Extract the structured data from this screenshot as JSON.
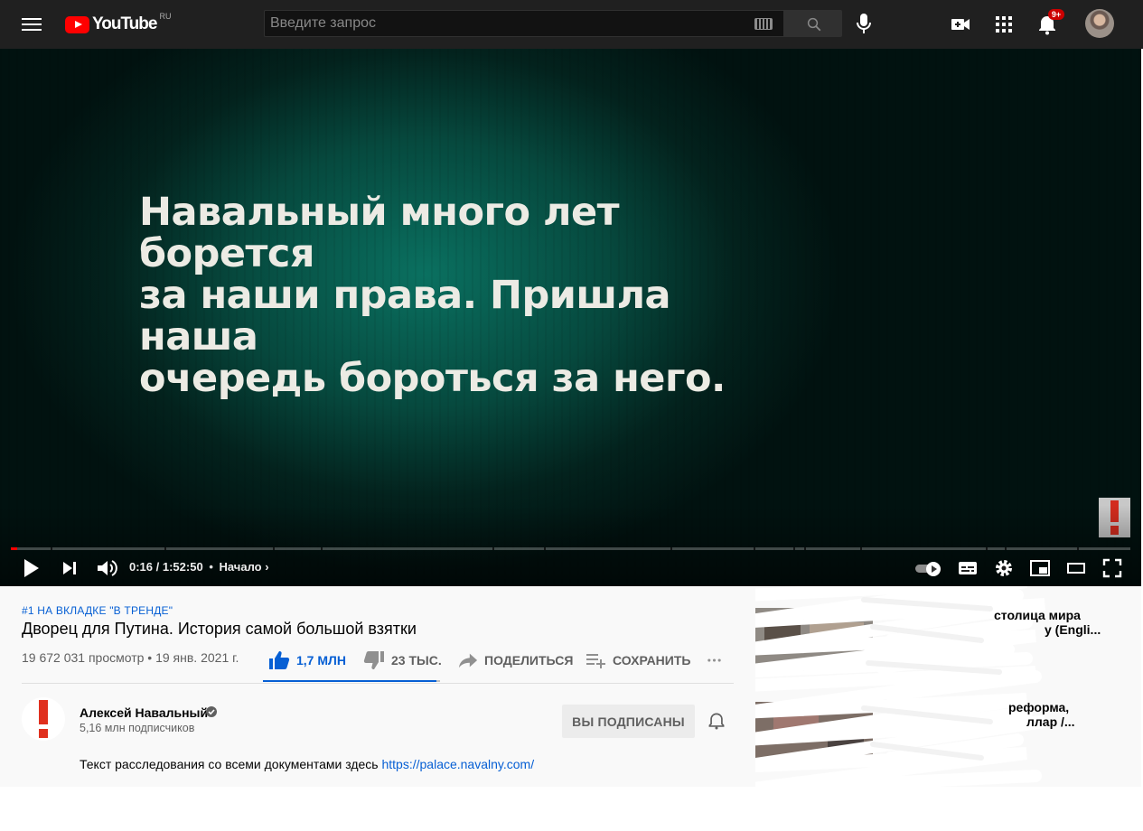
{
  "header": {
    "logo_text": "YouTube",
    "region": "RU",
    "search_placeholder": "Введите запрос",
    "notification_count": "9+"
  },
  "player": {
    "overlay_text_lines": [
      "Навальный много лет борется",
      "за наши права. Пришла наша",
      "очередь бороться за него."
    ],
    "current_time": "0:16",
    "duration": "1:52:50",
    "separator": "•",
    "chapter": "Начало",
    "progress_fraction": 0.006,
    "accent_color": "#ff0000"
  },
  "video": {
    "trend_tag": "#1 НА ВКЛАДКЕ \"В ТРЕНДЕ\"",
    "title": "Дворец для Путина. История самой большой взятки",
    "views_date": "19 672 031 просмотр • 19 янв. 2021 г.",
    "like_count": "1,7 МЛН",
    "dislike_count": "23 ТЫС.",
    "share_label": "ПОДЕЛИТЬСЯ",
    "save_label": "СОХРАНИТЬ",
    "like_ratio": 0.98,
    "link_color": "#065fd4"
  },
  "channel": {
    "name": "Алексей Навальный",
    "subscribers": "5,16 млн подписчиков",
    "subscribed_label": "ВЫ ПОДПИСАНЫ"
  },
  "description": {
    "text": "Текст расследования со всеми документами здесь ",
    "link": "https://palace.navalny.com/"
  },
  "sidebar": {
    "fragments": [
      "столица мира",
      "y (Engli...",
      "реформа,",
      "ллар /..."
    ]
  }
}
